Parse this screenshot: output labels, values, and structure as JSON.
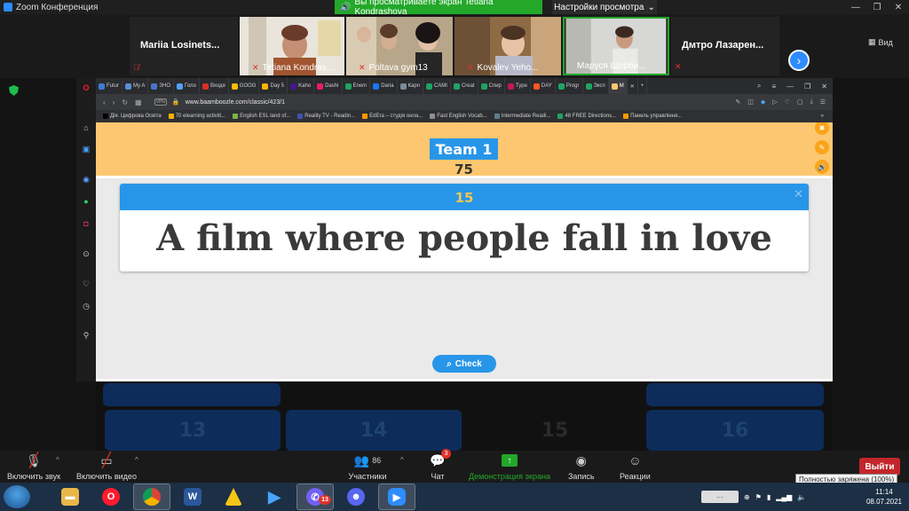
{
  "zoom": {
    "window_title": "Zoom Конференция",
    "share_banner": "Вы просматриваете экран Tetiana Kondrashova",
    "view_settings": "Настройки просмотра",
    "view_button": "Вид"
  },
  "participants": [
    {
      "name": "Mariia  Losinets..."
    },
    {
      "name": "Tetiana Kondras..."
    },
    {
      "name": "Poltava gym13"
    },
    {
      "name": "Kovalev Yeho..."
    },
    {
      "name": "Маруся Щерби..."
    },
    {
      "name": "Дмтро  Лазарен..."
    }
  ],
  "browser": {
    "tabs": [
      {
        "label": "Futur",
        "color": "#3a7bd5"
      },
      {
        "label": "My A",
        "color": "#5b8dd9"
      },
      {
        "label": "ЗНО",
        "color": "#4a76c9"
      },
      {
        "label": "Голо",
        "color": "#54a0ff"
      },
      {
        "label": "Входя",
        "color": "#d93025"
      },
      {
        "label": "GOOG",
        "color": "#fbbc05"
      },
      {
        "label": "Day 5",
        "color": "#f4b400"
      },
      {
        "label": "Kaho",
        "color": "#46178f"
      },
      {
        "label": "Dashi",
        "color": "#e91e63"
      },
      {
        "label": "Enem",
        "color": "#1ea362"
      },
      {
        "label": "Daria",
        "color": "#1877f2"
      },
      {
        "label": "Карп",
        "color": "#7b8c9a"
      },
      {
        "label": "CAMI",
        "color": "#1ea362"
      },
      {
        "label": "Creat",
        "color": "#1ea362"
      },
      {
        "label": "Спир",
        "color": "#1ea362"
      },
      {
        "label": "Type",
        "color": "#c2185b"
      },
      {
        "label": "DAY",
        "color": "#ff5722"
      },
      {
        "label": "Progr",
        "color": "#1ea362"
      },
      {
        "label": "Эксп",
        "color": "#1ea362"
      },
      {
        "label": "M",
        "color": "#fcc770"
      }
    ],
    "url": "www.baamboozle.com/classic/423/1",
    "vpn": "VPN",
    "bookmarks": [
      {
        "label": "Дія. Цифрова Освіта",
        "color": "#000000"
      },
      {
        "label": "70 elearning activiti...",
        "color": "#f4b400"
      },
      {
        "label": "English ESL land of...",
        "color": "#7cb342"
      },
      {
        "label": "Reality TV - Readin...",
        "color": "#3f51b5"
      },
      {
        "label": "EdEra – студія онла...",
        "color": "#ff9800"
      },
      {
        "label": "Fast English Vocab...",
        "color": "#8e8e8e"
      },
      {
        "label": "Intermediate Readi...",
        "color": "#607d8b"
      },
      {
        "label": "48 FREE Directions...",
        "color": "#1ea362"
      },
      {
        "label": "Панель управління...",
        "color": "#ff9800"
      }
    ]
  },
  "game": {
    "team_name": "Team 1",
    "team_score": "75",
    "question_points": "15",
    "question_text": "A film where people fall in love",
    "check_label": "Check",
    "close_glyph": "✕",
    "grid_numbers": [
      "13",
      "14",
      "15",
      "16"
    ],
    "band_buttons": [
      "✖",
      "✎",
      "🔊"
    ]
  },
  "toolbar": {
    "audio": "Включить звук",
    "video": "Включить видео",
    "participants_label": "Участники",
    "participants_count": "86",
    "chat_label": "Чат",
    "chat_badge": "3",
    "share_label": "Демонстрация экрана",
    "record_label": "Запись",
    "reactions_label": "Реакции",
    "leave_label": "Выйти",
    "battery_tooltip": "Полностью заряжена (100%)"
  },
  "taskbar": {
    "apps": [
      "explorer",
      "opera",
      "chrome",
      "word",
      "archicad",
      "media",
      "viber",
      "discord",
      "zoom"
    ],
    "viber_badge": "13",
    "time": "11:14",
    "date": "08.07.2021"
  },
  "colors": {
    "accent_blue": "#2896e8",
    "team_band": "#fcc770",
    "share_green": "#23a829",
    "leave_red": "#c3262a"
  }
}
